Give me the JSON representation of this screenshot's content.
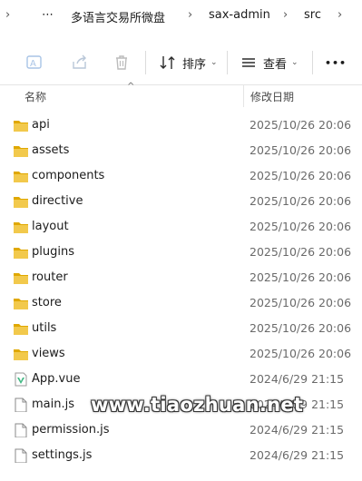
{
  "breadcrumb": {
    "more": "⋯",
    "items": [
      "多语言交易所微盘",
      "sax-admin",
      "src"
    ]
  },
  "toolbar": {
    "sort_label": "排序",
    "view_label": "查看",
    "more": "•••"
  },
  "columns": {
    "name": "名称",
    "modified": "修改日期"
  },
  "files": [
    {
      "name": "api",
      "date": "2025/10/26 20:06",
      "type": "folder"
    },
    {
      "name": "assets",
      "date": "2025/10/26 20:06",
      "type": "folder"
    },
    {
      "name": "components",
      "date": "2025/10/26 20:06",
      "type": "folder"
    },
    {
      "name": "directive",
      "date": "2025/10/26 20:06",
      "type": "folder"
    },
    {
      "name": "layout",
      "date": "2025/10/26 20:06",
      "type": "folder"
    },
    {
      "name": "plugins",
      "date": "2025/10/26 20:06",
      "type": "folder"
    },
    {
      "name": "router",
      "date": "2025/10/26 20:06",
      "type": "folder"
    },
    {
      "name": "store",
      "date": "2025/10/26 20:06",
      "type": "folder"
    },
    {
      "name": "utils",
      "date": "2025/10/26 20:06",
      "type": "folder"
    },
    {
      "name": "views",
      "date": "2025/10/26 20:06",
      "type": "folder"
    },
    {
      "name": "App.vue",
      "date": "2024/6/29 21:15",
      "type": "vue"
    },
    {
      "name": "main.js",
      "date": "2024/6/29 21:15",
      "type": "file"
    },
    {
      "name": "permission.js",
      "date": "2024/6/29 21:15",
      "type": "file"
    },
    {
      "name": "settings.js",
      "date": "2024/6/29 21:15",
      "type": "file"
    }
  ],
  "watermark": "www.tiaozhuan.net",
  "colors": {
    "folder": "#f2c94c",
    "folder_dark": "#e0a800",
    "vue": "#41b883"
  }
}
